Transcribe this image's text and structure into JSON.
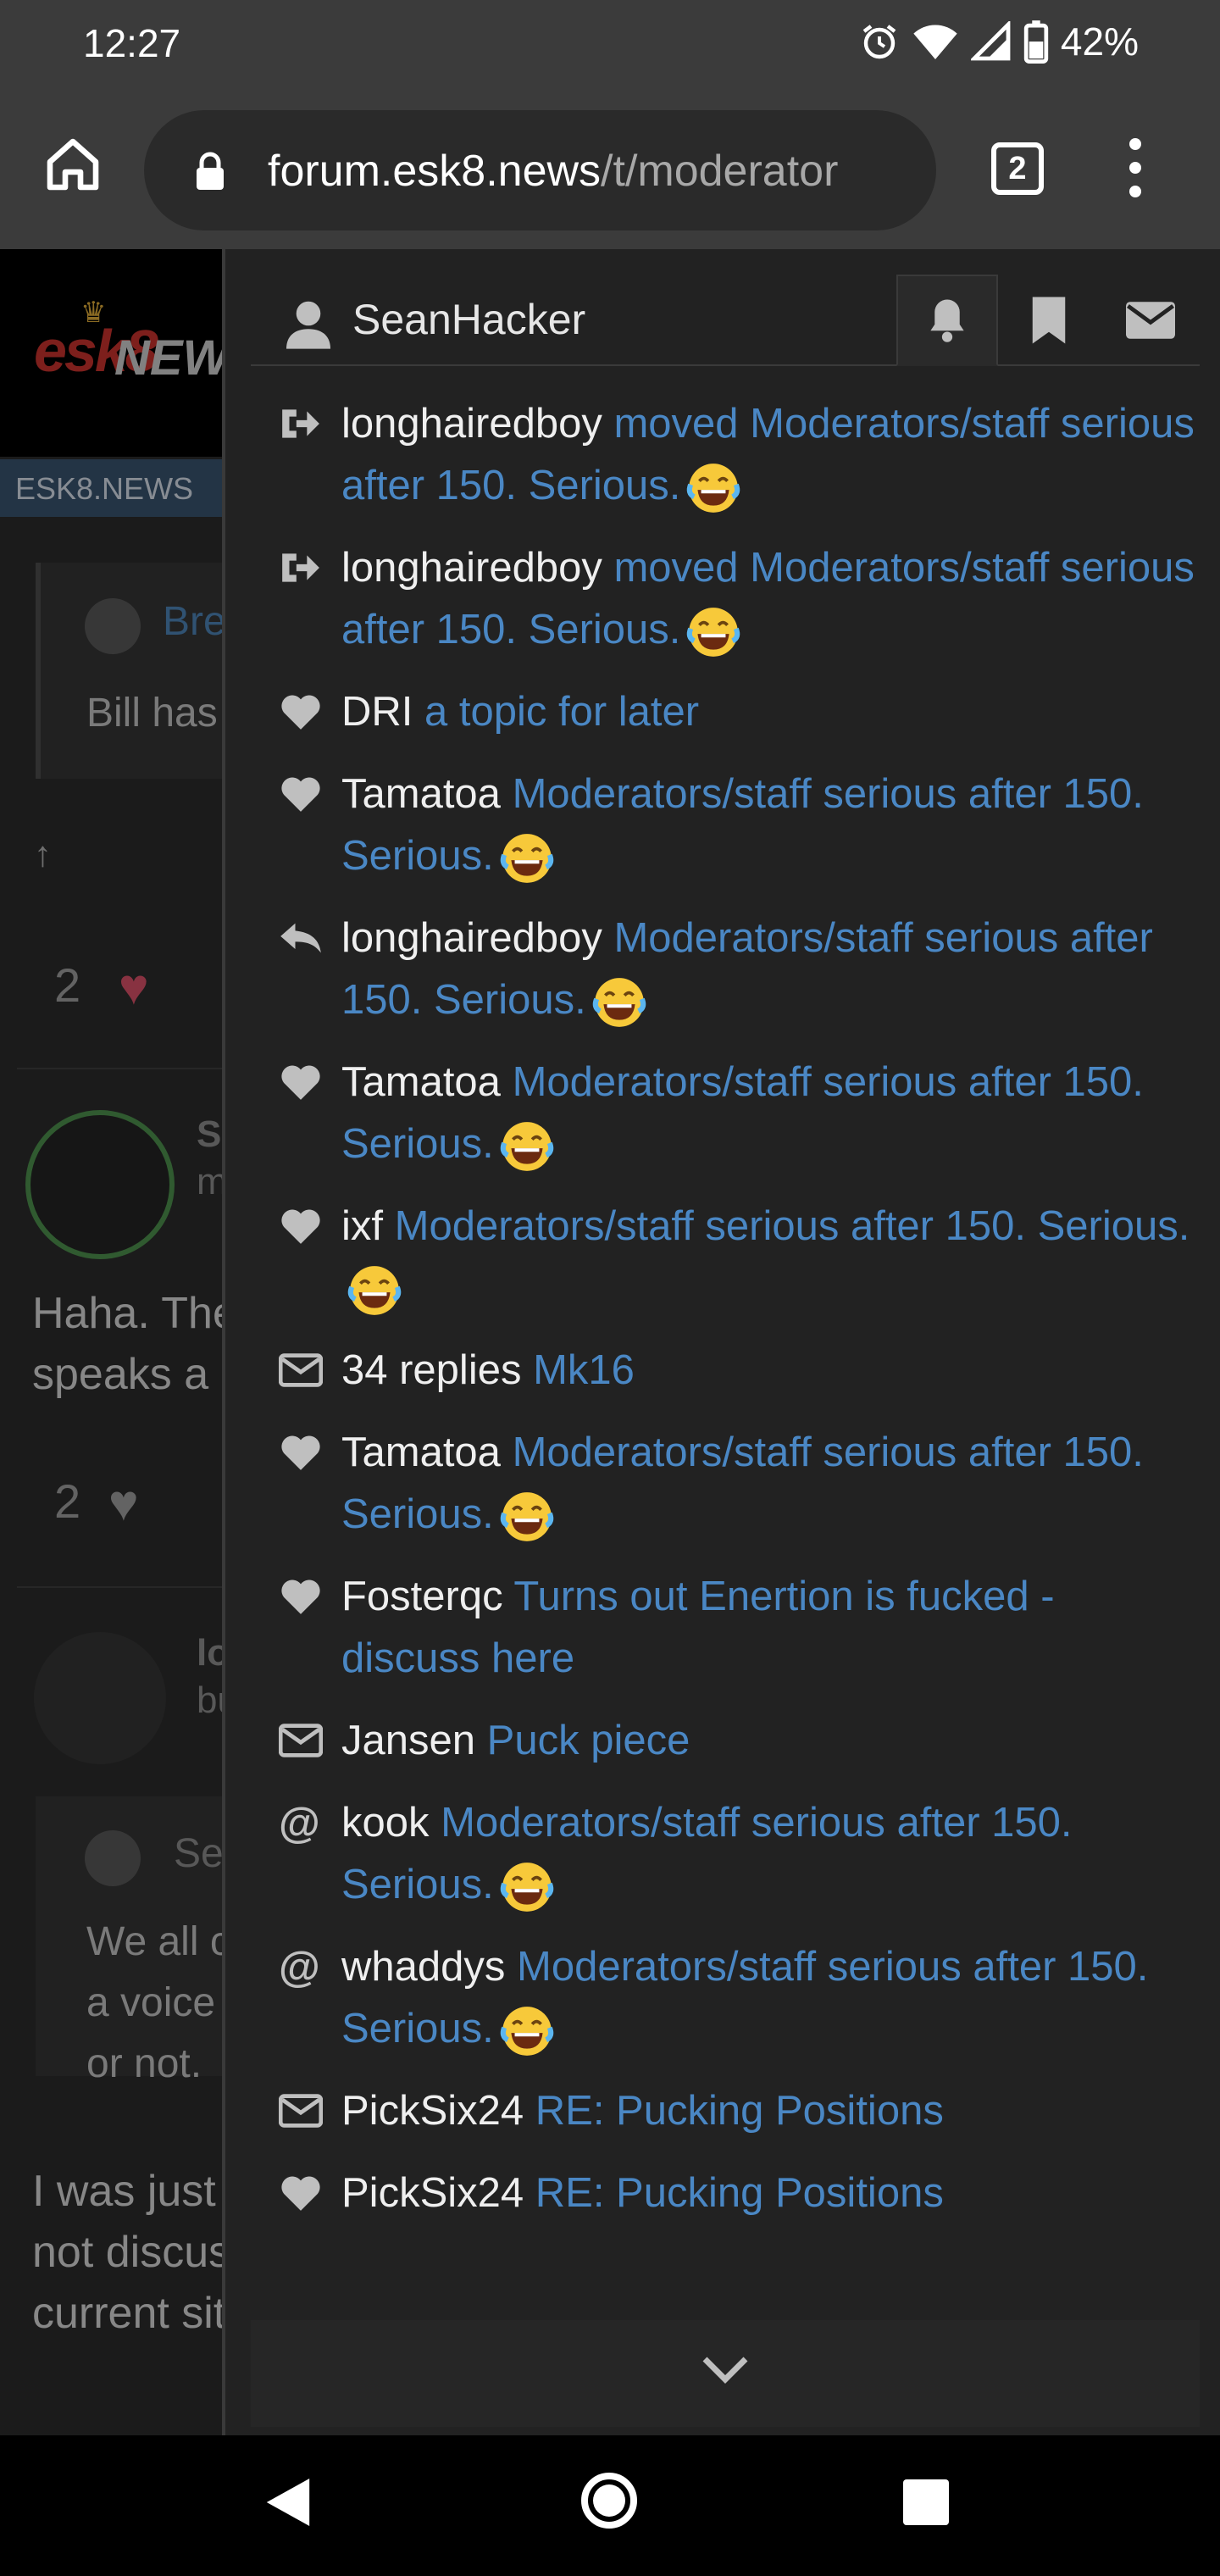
{
  "status_bar": {
    "time": "12:27",
    "battery": "42%"
  },
  "browser": {
    "url_host": "forum.esk8.news",
    "url_path": "/t/moderator",
    "tab_count": "2"
  },
  "background_page": {
    "site_tag": "ESK8.NEWS",
    "logo_left": "esk8",
    "logo_right": "NEW",
    "quote1_name": "Bre",
    "quote1_text": "Bill has",
    "up_arrow": "↑",
    "like_count_1": "2",
    "post1_name_fragment": "S",
    "post1_sub_fragment": "m",
    "post1_line1": "Haha. The",
    "post1_line2": "speaks a",
    "like_count_2": "2",
    "post2_name_fragment": "lo",
    "post2_sub_fragment": "bu",
    "quote2_name": "Se",
    "quote2_line1": "We all c",
    "quote2_line2": "a voice",
    "quote2_line3": "or not.",
    "post2_line1": "I was just",
    "post2_line2": "not discus",
    "post2_line3": "current sit"
  },
  "panel": {
    "username": "SeanHacker",
    "tabs": [
      "notifications",
      "bookmarks",
      "messages"
    ],
    "notifications": [
      {
        "icon": "moved-icon",
        "user": "longhairedboy",
        "text": "moved Moderators/staff serious after 150. Serious.",
        "emoji": true
      },
      {
        "icon": "moved-icon",
        "user": "longhairedboy",
        "text": "moved Moderators/staff serious after 150. Serious.",
        "emoji": true
      },
      {
        "icon": "heart-icon",
        "user": "DRI",
        "text": "a topic for later",
        "emoji": false
      },
      {
        "icon": "heart-icon",
        "user": "Tamatoa",
        "text": "Moderators/staff serious after 150. Serious.",
        "emoji": true
      },
      {
        "icon": "reply-icon",
        "user": "longhairedboy",
        "text": "Moderators/staff serious after 150. Serious.",
        "emoji": true
      },
      {
        "icon": "heart-icon",
        "user": "Tamatoa",
        "text": "Moderators/staff serious after 150. Serious.",
        "emoji": true
      },
      {
        "icon": "heart-icon",
        "user": "ixf",
        "text": "Moderators/staff serious after 150. Serious.",
        "emoji": true
      },
      {
        "icon": "envelope-icon",
        "user": "34 replies",
        "text": "Mk16",
        "emoji": false
      },
      {
        "icon": "heart-icon",
        "user": "Tamatoa",
        "text": "Moderators/staff serious after 150. Serious.",
        "emoji": true
      },
      {
        "icon": "heart-icon",
        "user": "Fosterqc",
        "text": "Turns out Enertion is fucked - discuss here",
        "emoji": false
      },
      {
        "icon": "envelope-icon",
        "user": "Jansen",
        "text": "Puck piece",
        "emoji": false
      },
      {
        "icon": "mention-icon",
        "user": "kook",
        "text": "Moderators/staff serious after 150. Serious.",
        "emoji": true
      },
      {
        "icon": "mention-icon",
        "user": "whaddys",
        "text": "Moderators/staff serious after 150. Serious.",
        "emoji": true
      },
      {
        "icon": "envelope-icon",
        "user": "PickSix24",
        "text": "RE: Pucking Positions",
        "emoji": false
      },
      {
        "icon": "heart-icon",
        "user": "PickSix24",
        "text": "RE: Pucking Positions",
        "emoji": false
      }
    ]
  },
  "colors": {
    "link": "#4a87c4",
    "panel_bg": "#222222",
    "chrome_bg": "#3b3b3b"
  }
}
